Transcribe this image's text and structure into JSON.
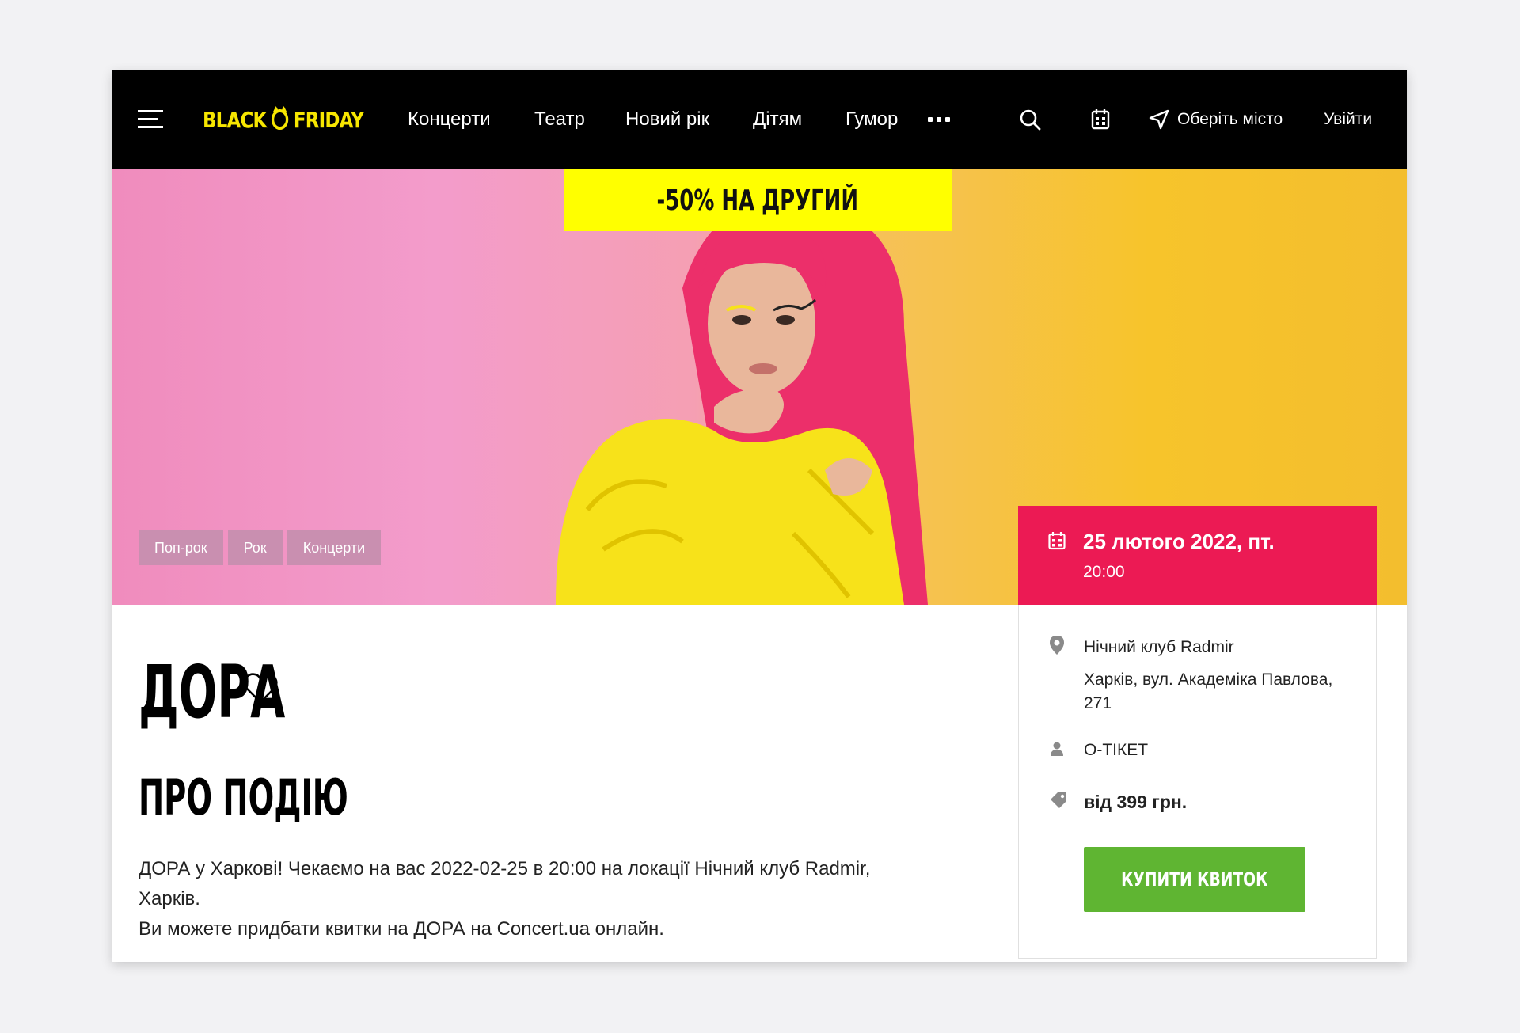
{
  "header": {
    "logo_left": "BLACK",
    "logo_right": "FRIDAY",
    "nav": [
      "Концерти",
      "Театр",
      "Новий рік",
      "Дітям",
      "Гумор"
    ],
    "city_label": "Оберіть місто",
    "login_label": "Увійти"
  },
  "hero": {
    "promo": "-50% НА ДРУГИЙ",
    "tags": [
      "Поп-рок",
      "Рок",
      "Концерти"
    ],
    "date": "25 лютого 2022, пт.",
    "time": "20:00"
  },
  "event": {
    "title": "ДОРА",
    "section_title": "ПРО ПОДІЮ",
    "description": [
      "ДОРА у Харкові! Чекаємо на вас 2022-02-25 в 20:00 на локації Нічний клуб Radmir,",
      "Харків.",
      "Ви можете придбати квитки на ДОРА на Concert.ua онлайн."
    ]
  },
  "panel": {
    "venue": "Нічний клуб Radmir",
    "address": "Харків, вул. Академіка Павлова, 271",
    "organizer": "О-ТІКЕТ",
    "price": "від 399 грн.",
    "buy_label": "КУПИТИ КВИТОК"
  },
  "colors": {
    "header_bg": "#000000",
    "logo": "#f7e600",
    "promo_bg": "#ffff00",
    "date_bg": "#ec1a54",
    "buy_bg": "#5fb532",
    "tag_bg": "#c98fb0"
  },
  "icons": [
    "menu-icon",
    "search-icon",
    "calendar-icon",
    "location-arrow-icon",
    "heart-icon",
    "map-pin-icon",
    "user-icon",
    "price-tag-icon"
  ]
}
